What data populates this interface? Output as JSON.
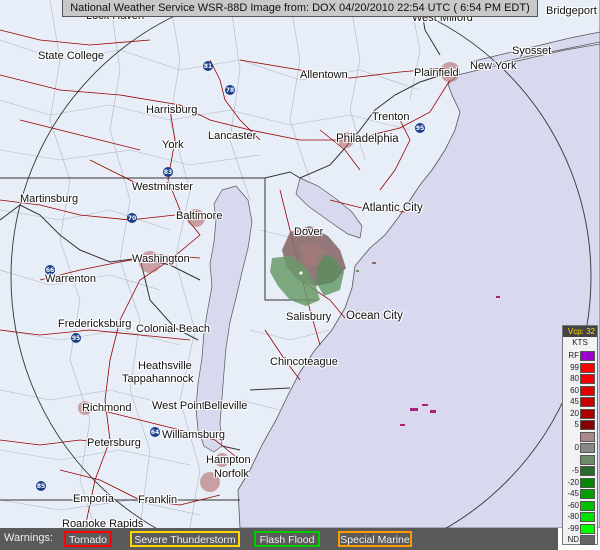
{
  "header": {
    "title": "National Weather Service WSR-88D Image from: DOX 04/20/2010 22:54 UTC ( 6:54 PM EDT)"
  },
  "cities": [
    {
      "name": "State College"
    },
    {
      "name": "Harrisburg"
    },
    {
      "name": "Lancaster"
    },
    {
      "name": "York"
    },
    {
      "name": "Allentown"
    },
    {
      "name": "Westminster"
    },
    {
      "name": "Martinsburg"
    },
    {
      "name": "Baltimore"
    },
    {
      "name": "Washington"
    },
    {
      "name": "Warrenton"
    },
    {
      "name": "Fredericksburg"
    },
    {
      "name": "Colonial Beach"
    },
    {
      "name": "Heathsville"
    },
    {
      "name": "Tappahannock"
    },
    {
      "name": "West Point"
    },
    {
      "name": "Belleville"
    },
    {
      "name": "Richmond"
    },
    {
      "name": "Williamsburg"
    },
    {
      "name": "Petersburg"
    },
    {
      "name": "Hampton"
    },
    {
      "name": "Norfolk"
    },
    {
      "name": "Emporia"
    },
    {
      "name": "Franklin"
    },
    {
      "name": "Roanoke Rapids"
    },
    {
      "name": "Philadelphia"
    },
    {
      "name": "Trenton"
    },
    {
      "name": "Plainfield"
    },
    {
      "name": "New York"
    },
    {
      "name": "Syosset"
    },
    {
      "name": "West Milford"
    },
    {
      "name": "Bridgeport"
    },
    {
      "name": "Atlantic City"
    },
    {
      "name": "Dover"
    },
    {
      "name": "Salisbury"
    },
    {
      "name": "Ocean City"
    },
    {
      "name": "Chincoteague"
    },
    {
      "name": "Lock Haven"
    }
  ],
  "highways": [
    "81",
    "78",
    "83",
    "70",
    "66",
    "95",
    "64",
    "85",
    "95"
  ],
  "legend": {
    "vcp": "Vcp: 32",
    "units": "KTS",
    "entries": [
      {
        "label": "RF",
        "color": "#9900cc"
      },
      {
        "label": "99",
        "color": "#ff0000"
      },
      {
        "label": "80",
        "color": "#f00000"
      },
      {
        "label": "60",
        "color": "#e00000"
      },
      {
        "label": "45",
        "color": "#c80000"
      },
      {
        "label": "20",
        "color": "#a80000"
      },
      {
        "label": "5",
        "color": "#880000"
      },
      {
        "label": "",
        "color": "#aa8888"
      },
      {
        "label": "0",
        "color": "#888888"
      },
      {
        "label": "",
        "color": "#6a8a6a"
      },
      {
        "label": "-5",
        "color": "#2a6a2a"
      },
      {
        "label": "-20",
        "color": "#008800"
      },
      {
        "label": "-45",
        "color": "#00a000"
      },
      {
        "label": "-60",
        "color": "#00c000"
      },
      {
        "label": "-80",
        "color": "#00e000"
      },
      {
        "label": "-99",
        "color": "#00ff00"
      },
      {
        "label": "ND",
        "color": "#666666"
      }
    ]
  },
  "warnings": {
    "label": "Warnings:",
    "items": [
      {
        "label": "Tornado",
        "color": "#ff0000"
      },
      {
        "label": "Severe Thunderstorm",
        "color": "#ffd700"
      },
      {
        "label": "Flash Flood",
        "color": "#00cc00"
      },
      {
        "label": "Special Marine",
        "color": "#ff9900"
      }
    ]
  },
  "colors": {
    "land": "#e8eef8",
    "water": "#d8d8ee",
    "county_line": "#aeb6c4",
    "state_line": "#333333",
    "road": "#990000",
    "range_ring": "#333333"
  }
}
